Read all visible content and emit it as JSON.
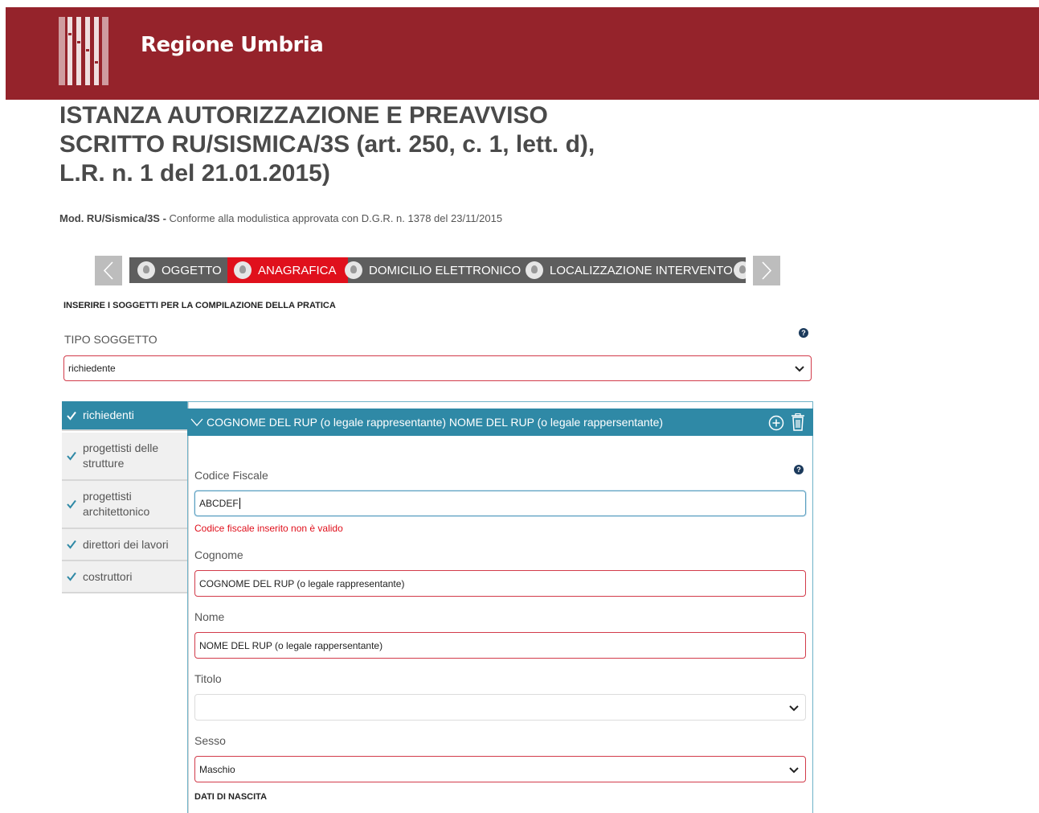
{
  "header": {
    "brand": "Regione Umbria"
  },
  "page": {
    "title": "ISTANZA AUTORIZZAZIONE E PREAVVISO SCRITTO RU/SISMICA/3S (art. 250, c. 1, lett. d), L.R. n. 1 del 21.01.2015)",
    "subtitle_bold": "Mod. RU/Sismica/3S -",
    "subtitle_text": " Conforme alla modulistica approvata con D.G.R. n. 1378 del  23/11/2015"
  },
  "steps": [
    {
      "label": "OGGETTO",
      "active": false
    },
    {
      "label": "ANAGRAFICA",
      "active": true
    },
    {
      "label": "DOMICILIO ELETTRONICO",
      "active": false
    },
    {
      "label": "LOCALIZZAZIONE INTERVENTO",
      "active": false
    }
  ],
  "section_heading": "INSERIRE I SOGGETTI PER LA COMPILAZIONE DELLA PRATICA",
  "tipo_soggetto": {
    "label": "TIPO SOGGETTO",
    "value": "richiedente"
  },
  "sidebar": {
    "items": [
      {
        "label": "richiedenti",
        "active": true
      },
      {
        "label": "progettisti delle strutture",
        "active": false
      },
      {
        "label": "progettisti architettonico",
        "active": false
      },
      {
        "label": "direttori dei lavori",
        "active": false
      },
      {
        "label": "costruttori",
        "active": false
      }
    ]
  },
  "panel": {
    "title": "COGNOME DEL RUP (o legale rappresentante) NOME DEL RUP (o legale rappersentante)"
  },
  "form": {
    "codice_fiscale": {
      "label": "Codice Fiscale",
      "value": "ABCDEF",
      "error": "Codice fiscale inserito non è valido"
    },
    "cognome": {
      "label": "Cognome",
      "value": "COGNOME DEL RUP (o legale rappresentante)"
    },
    "nome": {
      "label": "Nome",
      "value": "NOME DEL RUP (o legale rappersentante)"
    },
    "titolo": {
      "label": "Titolo",
      "value": ""
    },
    "sesso": {
      "label": "Sesso",
      "value": "Maschio"
    },
    "dati_nascita": "DATI DI NASCITA"
  },
  "colors": {
    "header": "#95232b",
    "accent": "#2f89a6",
    "active_step": "#e0101c",
    "error": "#e0101c"
  }
}
